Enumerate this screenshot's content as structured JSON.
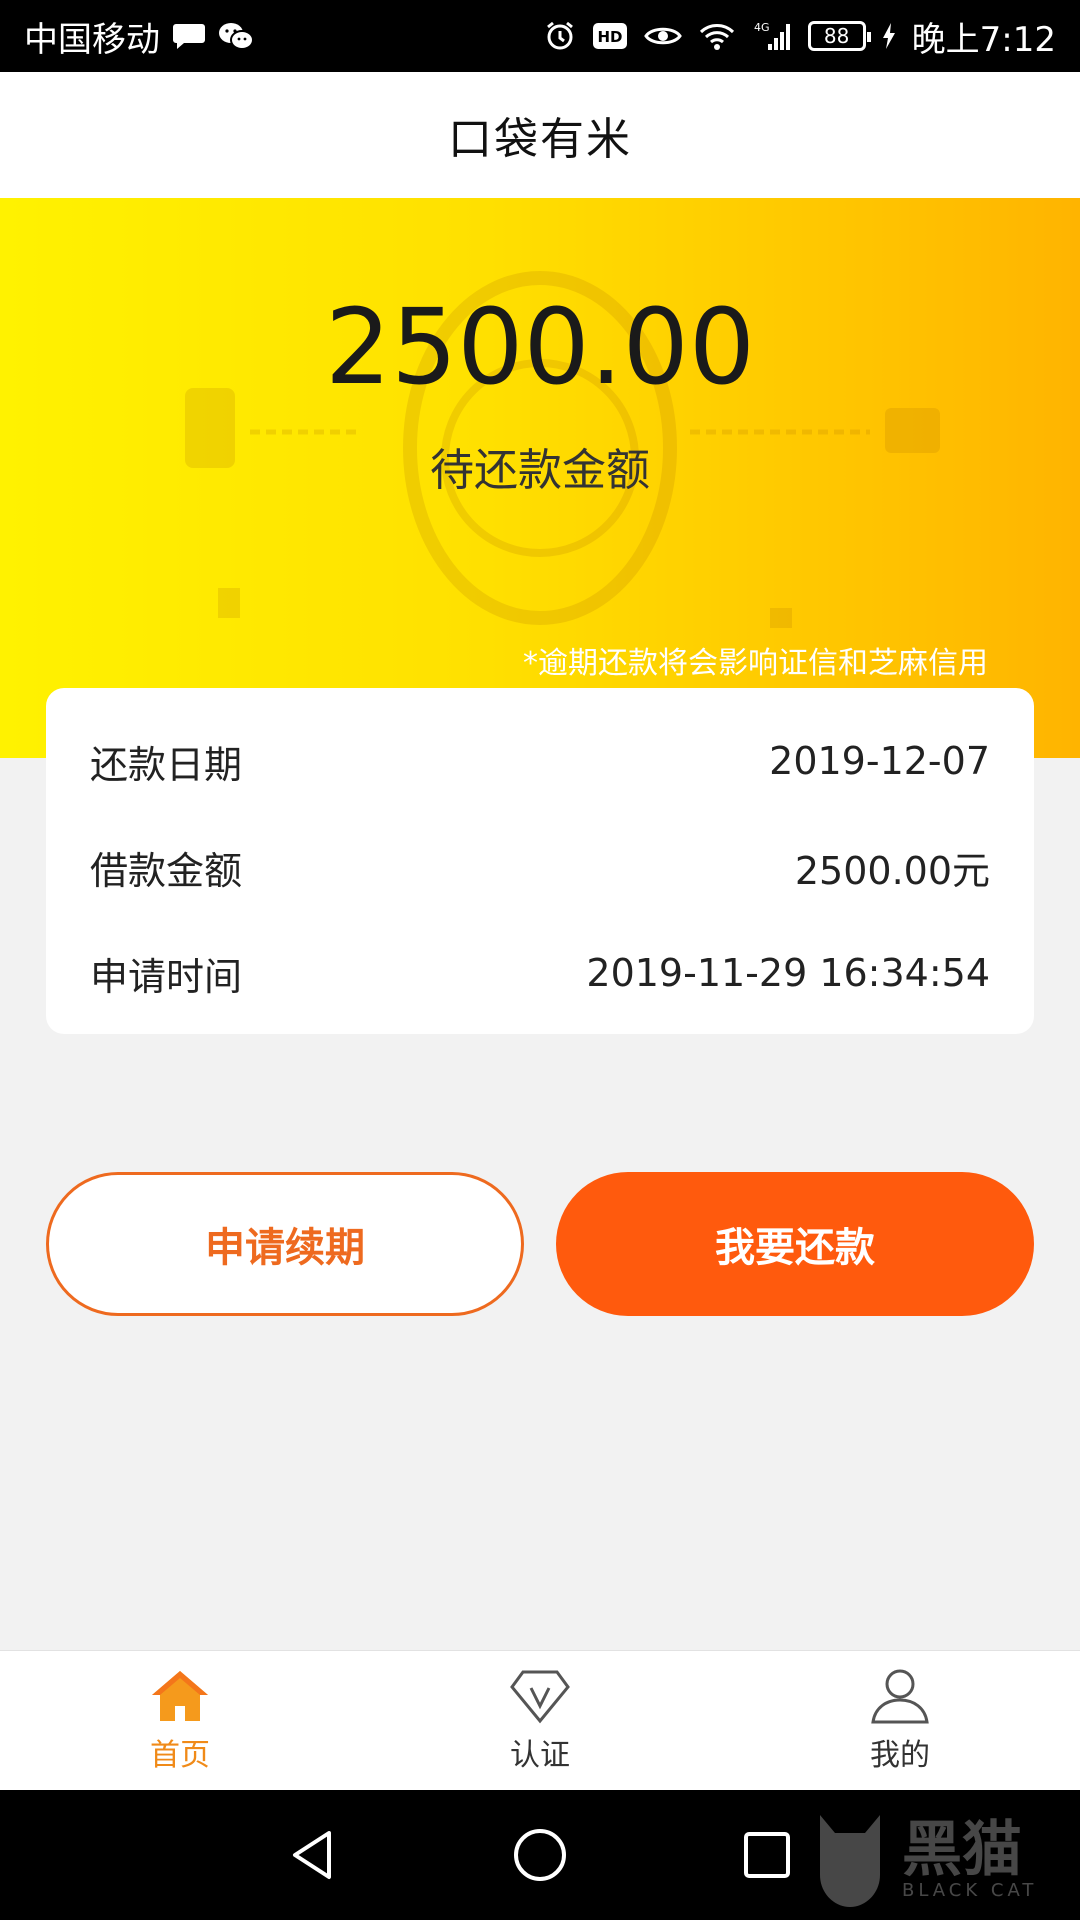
{
  "status_bar": {
    "carrier": "中国移动",
    "network": "4G",
    "battery": "88",
    "time": "晚上7:12",
    "icons": [
      "message-bubble-icon",
      "wechat-icon",
      "alarm-icon",
      "hd-icon",
      "eye-icon",
      "wifi-icon",
      "signal-icon",
      "charging-icon"
    ]
  },
  "header": {
    "title": "口袋有米"
  },
  "hero": {
    "amount": "2500.00",
    "amount_label": "待还款金额",
    "notice": "*逾期还款将会影响证信和芝麻信用"
  },
  "details": {
    "rows": [
      {
        "label": "还款日期",
        "value": "2019-12-07"
      },
      {
        "label": "借款金额",
        "value": "2500.00元"
      },
      {
        "label": "申请时间",
        "value": "2019-11-29 16:34:54"
      }
    ]
  },
  "actions": {
    "renew_label": "申请续期",
    "repay_label": "我要还款"
  },
  "bottom_nav": {
    "items": [
      {
        "label": "首页",
        "icon": "home-icon",
        "active": true
      },
      {
        "label": "认证",
        "icon": "verify-diamond-icon",
        "active": false
      },
      {
        "label": "我的",
        "icon": "user-icon",
        "active": false
      }
    ]
  },
  "watermark": {
    "cn": "黑猫",
    "en": "BLACK CAT"
  },
  "colors": {
    "accent_orange": "#ff5a0d",
    "nav_active": "#f08a18",
    "hero_yellow": "#ffe000"
  }
}
